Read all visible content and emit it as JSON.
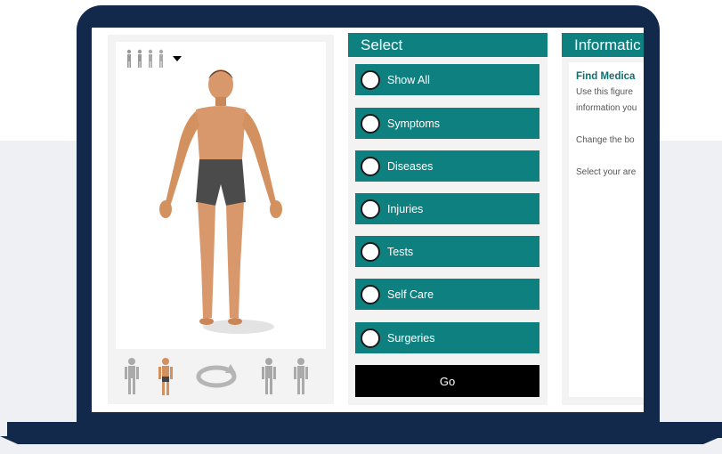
{
  "select_panel": {
    "heading": "Select",
    "options": [
      "Show All",
      "Symptoms",
      "Diseases",
      "Injuries",
      "Tests",
      "Self Care",
      "Surgeries"
    ],
    "go_label": "Go"
  },
  "info_panel": {
    "heading": "Informatic",
    "title": "Find Medica",
    "lines": [
      "Use this figure",
      "information you",
      "Change the bo",
      "Select your are"
    ]
  },
  "colors": {
    "teal": "#0e8080",
    "frame": "#13294b",
    "go_button": "#000000"
  },
  "icons": {
    "view_selector": "body-views-icon",
    "rotate": "rotate-icon"
  }
}
